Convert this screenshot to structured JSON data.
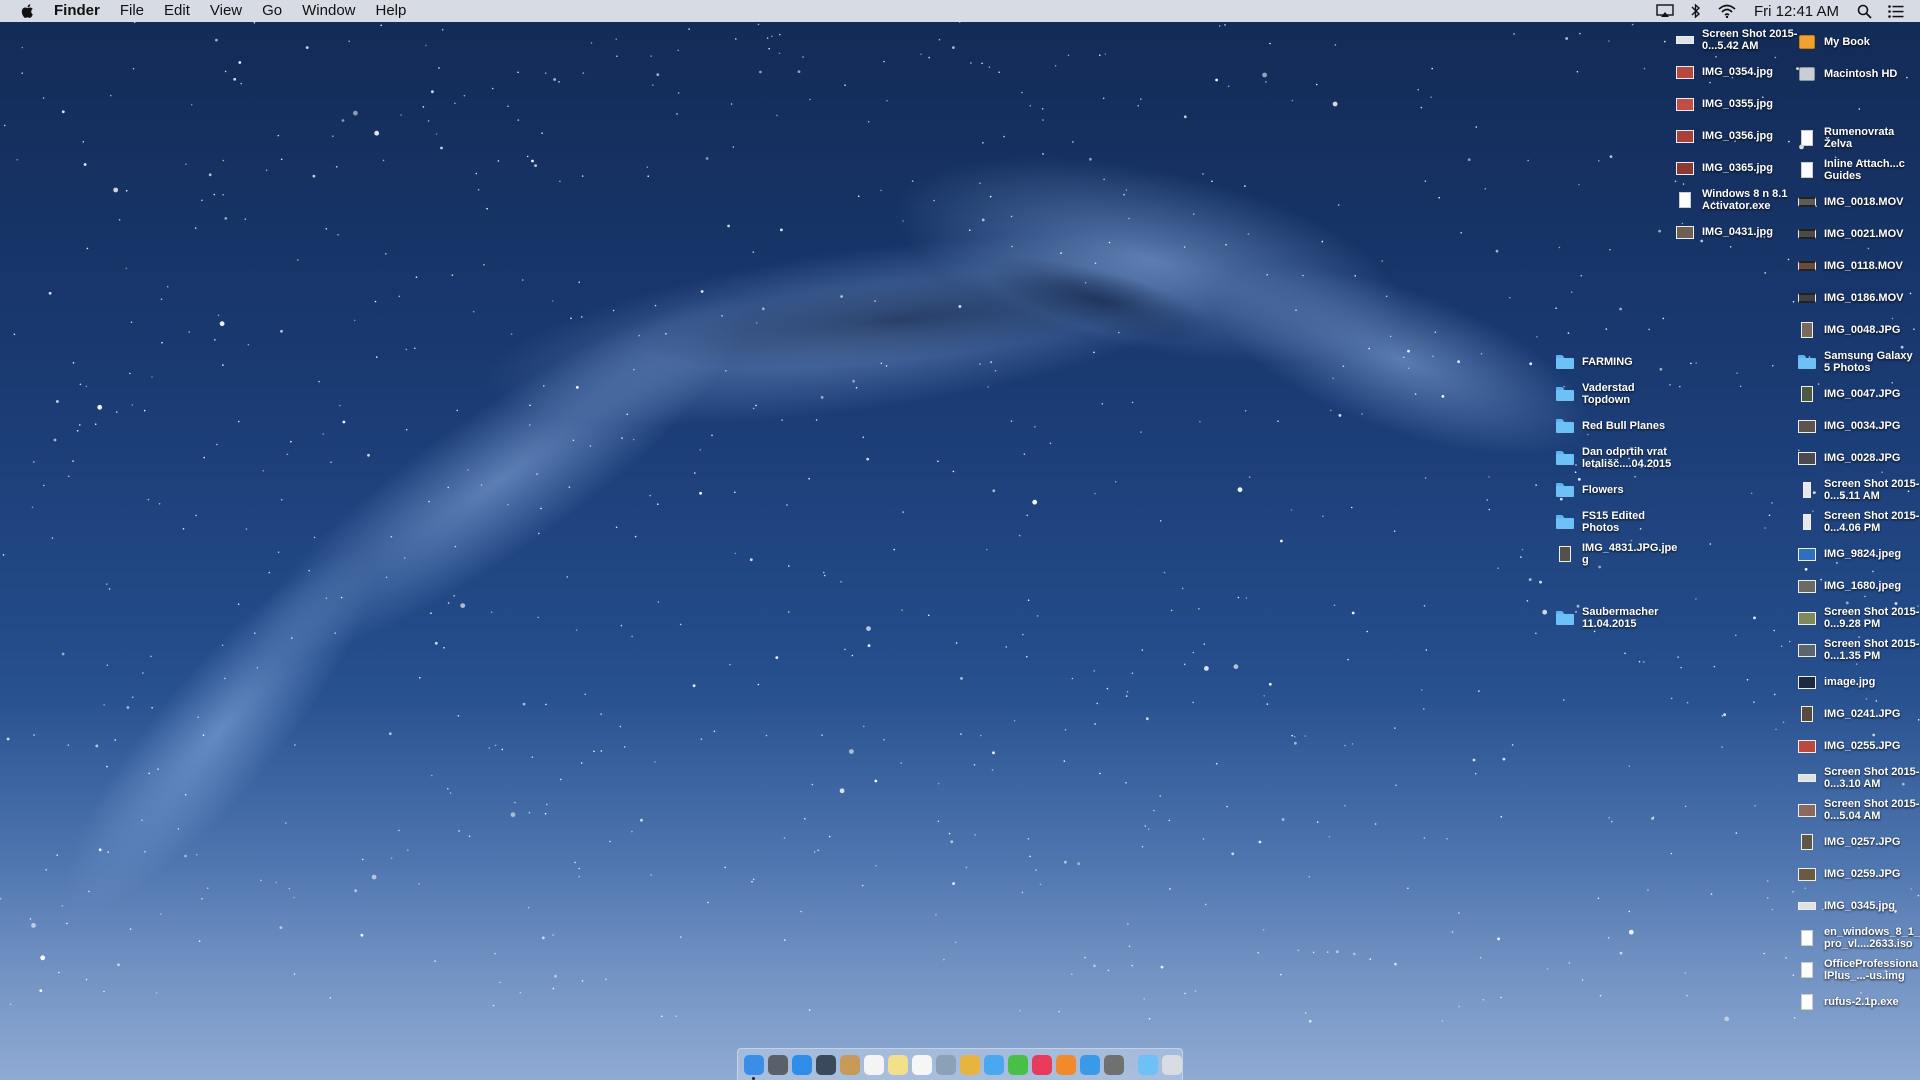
{
  "menubar": {
    "app_name": "Finder",
    "menus": [
      "File",
      "Edit",
      "View",
      "Go",
      "Window",
      "Help"
    ],
    "clock": "Fri 12:41 AM",
    "status_icons": [
      "airplay-icon",
      "bluetooth-icon",
      "wifi-icon",
      "spotlight-icon",
      "notification-center-icon"
    ]
  },
  "desktop": {
    "column_a": [
      {
        "label": "Screen Shot 2015-0...5.42 AM",
        "kind": "screenshot"
      },
      {
        "label": "IMG_0354.jpg",
        "kind": "photo",
        "color": "#b7473f"
      },
      {
        "label": "IMG_0355.jpg",
        "kind": "photo",
        "color": "#c24d44"
      },
      {
        "label": "IMG_0356.jpg",
        "kind": "photo",
        "color": "#a9413a"
      },
      {
        "label": "IMG_0365.jpg",
        "kind": "photo",
        "color": "#8a3a32"
      },
      {
        "label": "Windows 8 n 8.1 Activator.exe",
        "kind": "document"
      },
      {
        "label": "IMG_0431.jpg",
        "kind": "photo",
        "color": "#6d6053"
      }
    ],
    "column_b": [
      {
        "label": "My Book",
        "kind": "external-drive"
      },
      {
        "label": "Macintosh HD",
        "kind": "internal-drive"
      },
      {
        "label": "",
        "kind": "empty"
      },
      {
        "label": "Rumenovrata Želva",
        "kind": "document"
      },
      {
        "label": "Inline Attach...c Guides",
        "kind": "document"
      },
      {
        "label": "IMG_0018.MOV",
        "kind": "video",
        "color": "#5f5a55"
      },
      {
        "label": "IMG_0021.MOV",
        "kind": "video",
        "color": "#4f4a46"
      },
      {
        "label": "IMG_0118.MOV",
        "kind": "video",
        "color": "#6a4b3c"
      },
      {
        "label": "IMG_0186.MOV",
        "kind": "video",
        "color": "#3f3f45"
      },
      {
        "label": "IMG_0048.JPG",
        "kind": "portrait",
        "color": "#7a6a5c"
      },
      {
        "label": "Samsung Galaxy 5 Photos",
        "kind": "folder"
      },
      {
        "label": "IMG_0047.JPG",
        "kind": "portrait",
        "color": "#4d5a3f"
      },
      {
        "label": "IMG_0034.JPG",
        "kind": "photo",
        "color": "#5d5450"
      },
      {
        "label": "IMG_0028.JPG",
        "kind": "photo",
        "color": "#4c4a4f"
      },
      {
        "label": "Screen Shot 2015-0...5.11 AM",
        "kind": "screenshot-portrait"
      },
      {
        "label": "Screen Shot 2015-0...4.06 PM",
        "kind": "screenshot-portrait"
      },
      {
        "label": "IMG_9824.jpeg",
        "kind": "photo",
        "color": "#2f6fbf"
      },
      {
        "label": "IMG_1680.jpeg",
        "kind": "photo",
        "color": "#6c6a65"
      },
      {
        "label": "Screen Shot 2015-0...9.28 PM",
        "kind": "photo",
        "color": "#7f8a5a"
      },
      {
        "label": "Screen Shot 2015-0...1.35 PM",
        "kind": "photo",
        "color": "#5c6470"
      },
      {
        "label": "image.jpg",
        "kind": "photo",
        "color": "#1c2a40"
      },
      {
        "label": "IMG_0241.JPG",
        "kind": "portrait",
        "color": "#5a4a3e"
      },
      {
        "label": "IMG_0255.JPG",
        "kind": "photo",
        "color": "#b94a3d"
      },
      {
        "label": "Screen Shot 2015-0...3.10 AM",
        "kind": "screenshot"
      },
      {
        "label": "Screen Shot 2015-0...5.04 AM",
        "kind": "photo",
        "color": "#8a6a60"
      },
      {
        "label": "IMG_0257.JPG",
        "kind": "portrait",
        "color": "#5f5646"
      },
      {
        "label": "IMG_0259.JPG",
        "kind": "photo",
        "color": "#6a5a42"
      },
      {
        "label": "IMG_0345.jpg",
        "kind": "screenshot"
      },
      {
        "label": "en_windows_8_1_pro_vl....2633.iso",
        "kind": "document"
      },
      {
        "label": "OfficeProfessionalPlus_...-us.img",
        "kind": "document"
      },
      {
        "label": "rufus-2.1p.exe",
        "kind": "document"
      }
    ],
    "column_c": [
      {
        "label": "FARMING",
        "kind": "folder"
      },
      {
        "label": "Vaderstad Topdown",
        "kind": "folder"
      },
      {
        "label": "Red Bull Planes",
        "kind": "folder"
      },
      {
        "label": "Dan odprtih vrat letališč....04.2015",
        "kind": "folder"
      },
      {
        "label": "Flowers",
        "kind": "folder"
      },
      {
        "label": "FS15 Edited Photos",
        "kind": "folder"
      },
      {
        "label": "IMG_4831.JPG.jpeg",
        "kind": "portrait",
        "color": "#55504a"
      },
      {
        "label": "",
        "kind": "empty"
      },
      {
        "label": "Saubermacher 11.04.2015",
        "kind": "folder"
      }
    ]
  },
  "dock": {
    "apps": [
      {
        "name": "finder-icon",
        "color": "#3a8ee8",
        "running": true
      },
      {
        "name": "launchpad-icon",
        "color": "#5a6068"
      },
      {
        "name": "safari-icon",
        "color": "#2f8ce8"
      },
      {
        "name": "photo-booth-icon",
        "color": "#3a4a5a"
      },
      {
        "name": "contacts-icon",
        "color": "#c89a5a"
      },
      {
        "name": "calendar-icon",
        "color": "#f4f4f4"
      },
      {
        "name": "notes-icon",
        "color": "#f2e08a"
      },
      {
        "name": "reminders-icon",
        "color": "#f6f6f6"
      },
      {
        "name": "preview-icon",
        "color": "#8aa2b8"
      },
      {
        "name": "photos-icon",
        "color": "#e8b440"
      },
      {
        "name": "messages-icon",
        "color": "#4aa8f0"
      },
      {
        "name": "facetime-icon",
        "color": "#48c048"
      },
      {
        "name": "itunes-icon",
        "color": "#e83a5a"
      },
      {
        "name": "ibooks-icon",
        "color": "#f08a2a"
      },
      {
        "name": "app-store-icon",
        "color": "#3a9ae8"
      },
      {
        "name": "system-preferences-icon",
        "color": "#707070"
      }
    ],
    "extras": [
      {
        "name": "downloads-folder-icon",
        "color": "#6ec1f7"
      },
      {
        "name": "trash-icon",
        "color": "#d8dde4"
      }
    ]
  }
}
